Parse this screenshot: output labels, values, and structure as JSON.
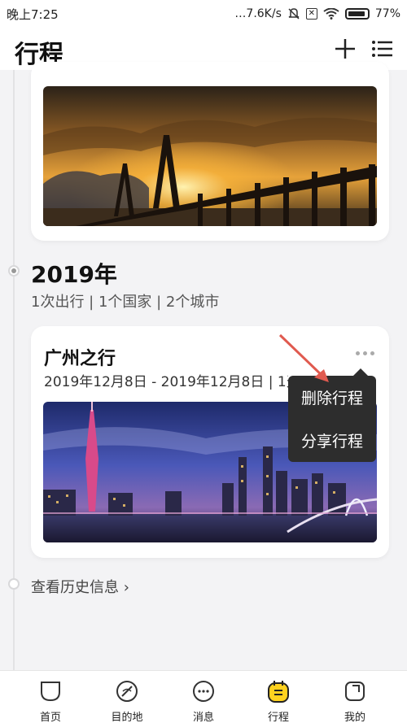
{
  "status_bar": {
    "time": "晚上7:25",
    "network_speed": "…7.6K/s",
    "battery": "77%"
  },
  "header": {
    "title": "行程",
    "add_icon": "plus-icon",
    "list_icon": "list-icon"
  },
  "year_section": {
    "year": "2019年",
    "stats": "1次出行 | 1个国家 | 2个城市"
  },
  "trip": {
    "title": "广州之行",
    "dates": "2019年12月8日 - 2019年12月8日 | 1天"
  },
  "popup_menu": {
    "items": [
      "删除行程",
      "分享行程"
    ]
  },
  "history_link": "查看历史信息 ›",
  "tab_bar": {
    "items": [
      {
        "label": "首页",
        "icon": "home-icon"
      },
      {
        "label": "目的地",
        "icon": "compass-icon"
      },
      {
        "label": "消息",
        "icon": "message-icon"
      },
      {
        "label": "行程",
        "icon": "trip-icon"
      },
      {
        "label": "我的",
        "icon": "profile-icon"
      }
    ]
  },
  "colors": {
    "accent": "#ffd21f",
    "popup_bg": "#2d2d2d",
    "arrow": "#e05a4f"
  }
}
